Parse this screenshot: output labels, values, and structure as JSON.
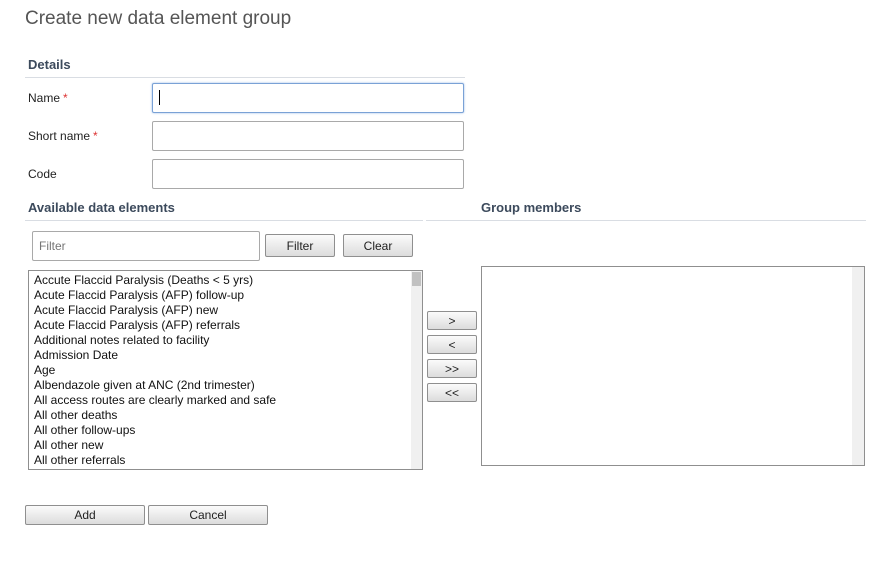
{
  "page": {
    "title": "Create new data element group"
  },
  "details": {
    "header": "Details",
    "name_label": "Name",
    "short_name_label": "Short name",
    "code_label": "Code",
    "required_mark": "*",
    "name_value": "",
    "short_name_value": "",
    "code_value": ""
  },
  "available": {
    "header": "Available data elements",
    "filter_placeholder": "Filter",
    "filter_button": "Filter",
    "clear_button": "Clear",
    "items": [
      "Accute Flaccid Paralysis (Deaths < 5 yrs)",
      "Acute Flaccid Paralysis (AFP) follow-up",
      "Acute Flaccid Paralysis (AFP) new",
      "Acute Flaccid Paralysis (AFP) referrals",
      "Additional notes related to facility",
      "Admission Date",
      "Age",
      "Albendazole given at ANC (2nd trimester)",
      "All access routes are clearly marked and safe",
      "All other deaths",
      "All other follow-ups",
      "All other new",
      "All other referrals"
    ]
  },
  "transfer": {
    "move_right": ">",
    "move_left": "<",
    "move_all_right": ">>",
    "move_all_left": "<<"
  },
  "members": {
    "header": "Group members",
    "items": []
  },
  "footer": {
    "add_button": "Add",
    "cancel_button": "Cancel"
  }
}
